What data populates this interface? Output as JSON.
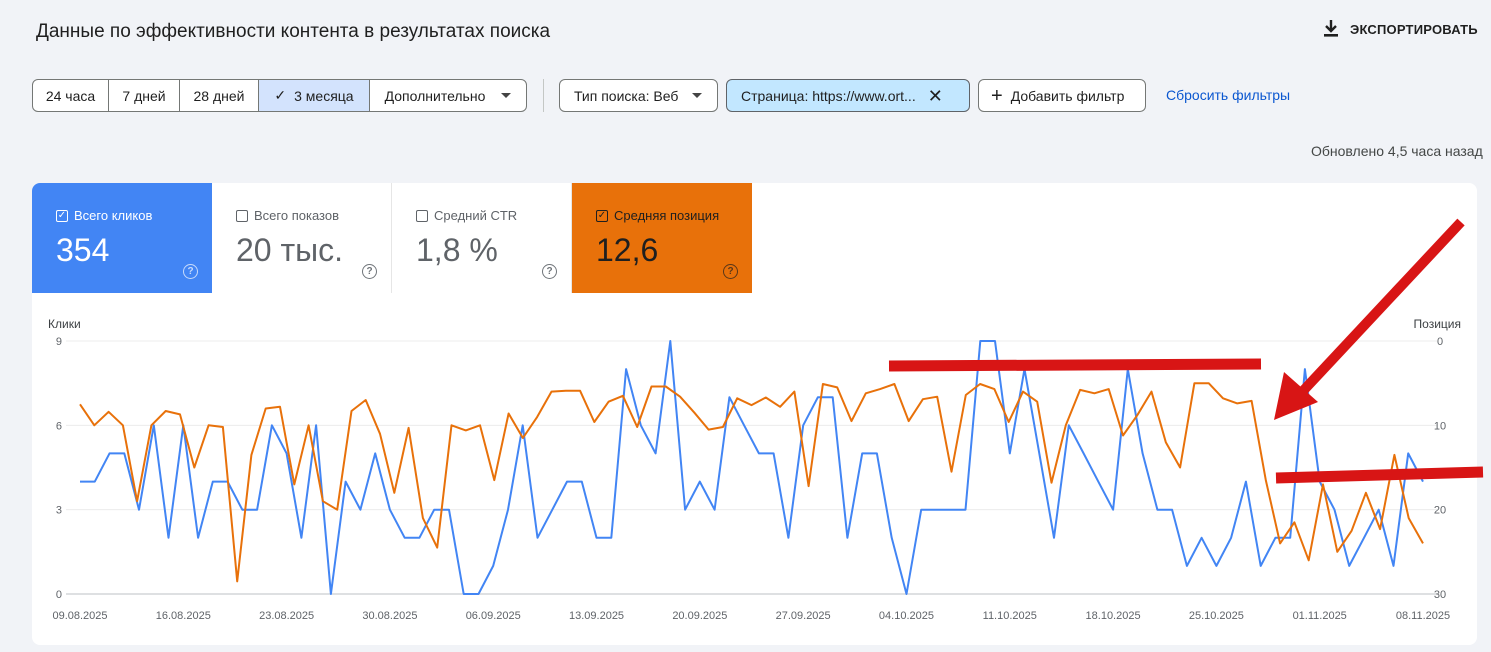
{
  "header": {
    "title": "Данные по эффективности контента в результатах поиска",
    "export_label": "ЭКСПОРТИРОВАТЬ"
  },
  "filters": {
    "ranges": [
      "24 часа",
      "7 дней",
      "28 дней",
      "3 месяца",
      "Дополнительно"
    ],
    "active_range": "3 месяца",
    "search_type": "Тип поиска: Веб",
    "page_filter": "Страница: https://www.ort...",
    "add_filter": "Добавить фильтр",
    "reset": "Сбросить фильтры"
  },
  "updated": "Обновлено 4,5 часа назад",
  "metrics": [
    {
      "label": "Всего кликов",
      "value": "354",
      "checked": true,
      "color": "#4285f4"
    },
    {
      "label": "Всего показов",
      "value": "20 тыс.",
      "checked": false,
      "color": "#5e35b1"
    },
    {
      "label": "Средний CTR",
      "value": "1,8 %",
      "checked": false,
      "color": "#00897b"
    },
    {
      "label": "Средняя позиция",
      "value": "12,6",
      "checked": true,
      "color": "#e8710a"
    }
  ],
  "chart_data": {
    "type": "line",
    "ylabel_left": "Клики",
    "ylabel_right": "Позиция",
    "yticks_left": [
      "0",
      "3",
      "6",
      "9"
    ],
    "yticks_right": [
      "0",
      "10",
      "20",
      "30"
    ],
    "ylim_left": [
      0,
      9
    ],
    "ylim_right": [
      30,
      0
    ],
    "x_start": "09.08.2025",
    "xtick_labels": [
      "09.08.2025",
      "16.08.2025",
      "23.08.2025",
      "30.08.2025",
      "06.09.2025",
      "13.09.2025",
      "20.09.2025",
      "27.09.2025",
      "04.10.2025",
      "11.10.2025",
      "18.10.2025",
      "25.10.2025",
      "01.11.2025",
      "08.11.2025"
    ],
    "series": [
      {
        "name": "Клики",
        "axis": "left",
        "color": "#4285f4",
        "values": [
          4,
          4,
          5,
          5,
          3,
          6,
          2,
          6,
          2,
          4,
          4,
          3,
          3,
          6,
          5,
          2,
          6,
          0,
          4,
          3,
          5,
          3,
          2,
          2,
          3,
          3,
          0,
          0,
          1,
          3,
          6,
          2,
          3,
          4,
          4,
          2,
          2,
          8,
          6,
          5,
          9,
          3,
          4,
          3,
          7,
          6,
          5,
          5,
          2,
          6,
          7,
          7,
          2,
          5,
          5,
          2,
          0,
          3,
          3,
          3,
          3,
          9,
          9,
          5,
          8,
          5,
          2,
          6,
          5,
          4,
          3,
          8,
          5,
          3,
          3,
          1,
          2,
          1,
          2,
          4,
          1,
          2,
          2,
          8,
          4,
          3,
          1,
          2,
          3,
          1,
          5,
          4
        ]
      },
      {
        "name": "Позиция",
        "axis": "right",
        "color": "#e8710a",
        "values": [
          7.5,
          10,
          8.4,
          10,
          19,
          10,
          8.3,
          8.7,
          15,
          10,
          10.2,
          28.5,
          13.5,
          8,
          7.8,
          17,
          10,
          19,
          20,
          8.3,
          7,
          11,
          18,
          10.3,
          21,
          24.5,
          10,
          10.6,
          10,
          16.5,
          8.6,
          11.5,
          9,
          6,
          5.9,
          5.9,
          9.6,
          7.2,
          6.5,
          10.2,
          5.4,
          5.4,
          6.6,
          8.5,
          10.5,
          10.2,
          6.8,
          7.6,
          6.7,
          7.8,
          6,
          17.2,
          5.1,
          5.5,
          9.5,
          6.2,
          5.7,
          5.1,
          9.5,
          6.9,
          6.6,
          15.5,
          6.4,
          5.1,
          5.7,
          9.6,
          6,
          7.2,
          16.8,
          10,
          5.8,
          6.2,
          5.7,
          11.2,
          8.8,
          6,
          12,
          15,
          5,
          5,
          6.8,
          7.4,
          7.1,
          16.5,
          24,
          21.5,
          26,
          17,
          25,
          22.5,
          18,
          22.3,
          13.5,
          21,
          24
        ]
      }
    ],
    "annotations": [
      "red-horizontal-bar",
      "red-horizontal-bar",
      "red-arrow"
    ]
  }
}
